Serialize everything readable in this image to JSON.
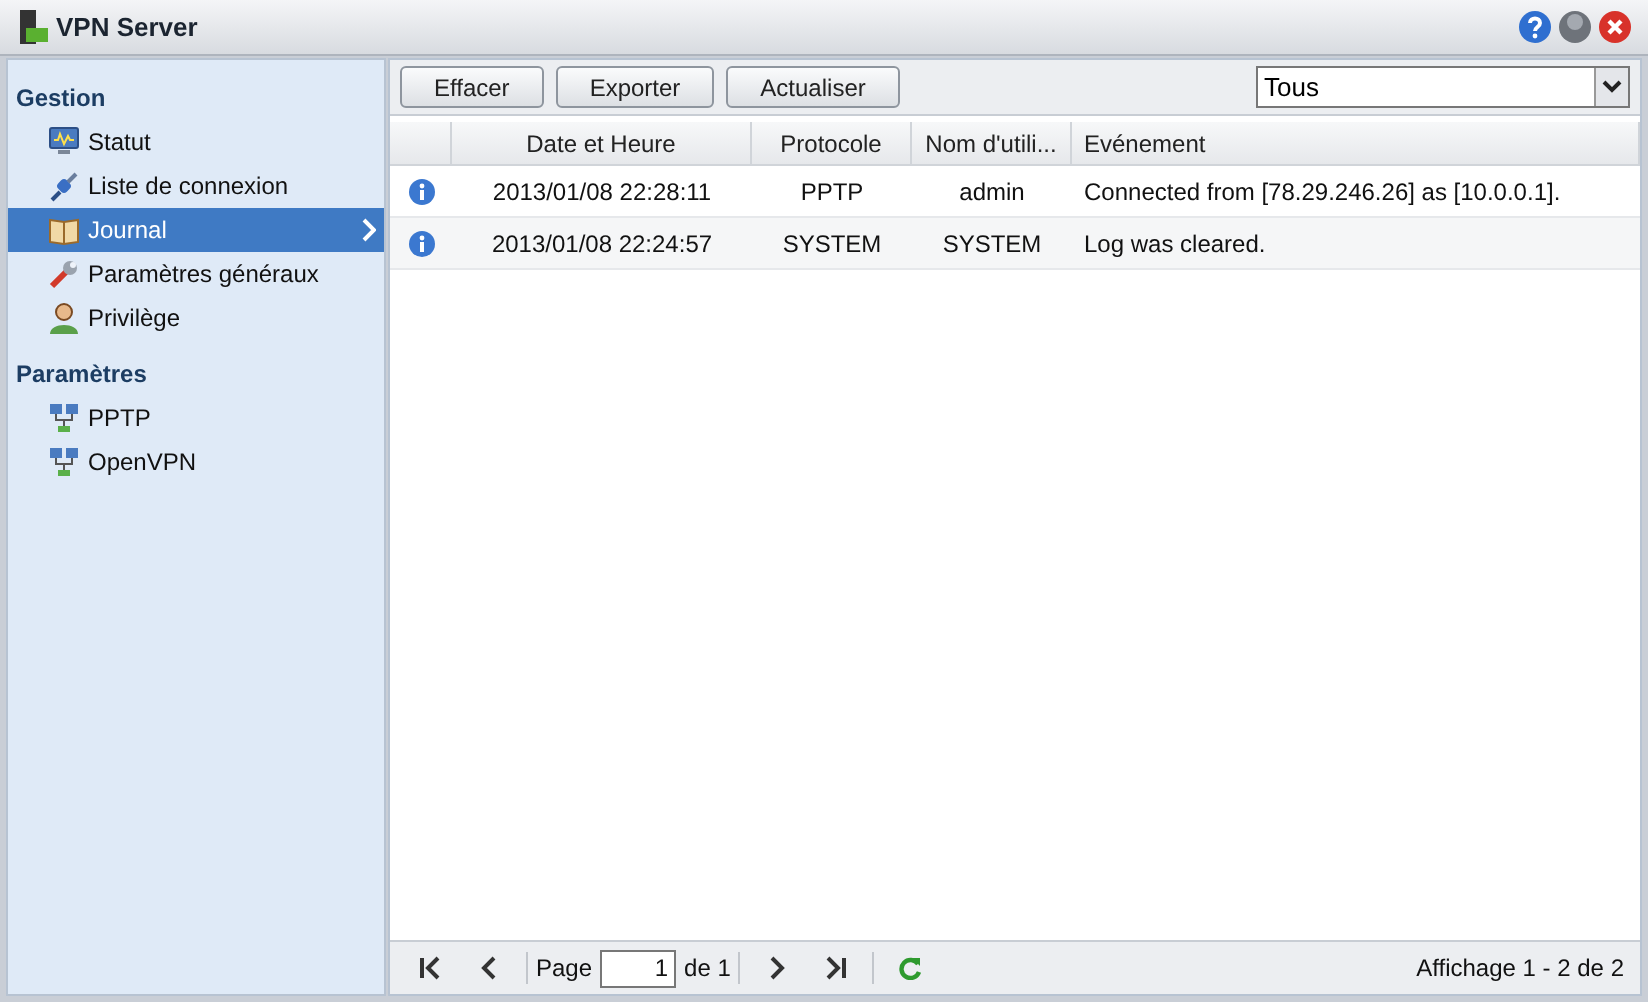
{
  "window": {
    "title": "VPN Server"
  },
  "sidebar": {
    "sections": [
      {
        "title": "Gestion",
        "items": [
          {
            "label": "Statut",
            "kind": "monitor",
            "selected": false
          },
          {
            "label": "Liste de connexion",
            "kind": "plug",
            "selected": false
          },
          {
            "label": "Journal",
            "kind": "book",
            "selected": true
          },
          {
            "label": "Paramètres généraux",
            "kind": "wrench",
            "selected": false
          },
          {
            "label": "Privilège",
            "kind": "person",
            "selected": false
          }
        ]
      },
      {
        "title": "Paramètres",
        "items": [
          {
            "label": "PPTP",
            "kind": "network",
            "selected": false
          },
          {
            "label": "OpenVPN",
            "kind": "network",
            "selected": false
          }
        ]
      }
    ]
  },
  "toolbar": {
    "buttons": [
      "Effacer",
      "Exporter",
      "Actualiser"
    ],
    "filter": "Tous"
  },
  "table": {
    "columns": [
      "Date et Heure",
      "Protocole",
      "Nom d'utili...",
      "Evénement"
    ],
    "rows": [
      {
        "date": "2013/01/08 22:28:11",
        "protocol": "PPTP",
        "user": "admin",
        "event": "Connected from [78.29.246.26] as [10.0.0.1]."
      },
      {
        "date": "2013/01/08 22:24:57",
        "protocol": "SYSTEM",
        "user": "SYSTEM",
        "event": "Log was cleared."
      }
    ]
  },
  "pager": {
    "page_label": "Page",
    "page": "1",
    "of": "de 1",
    "summary": "Affichage 1 - 2 de 2"
  }
}
